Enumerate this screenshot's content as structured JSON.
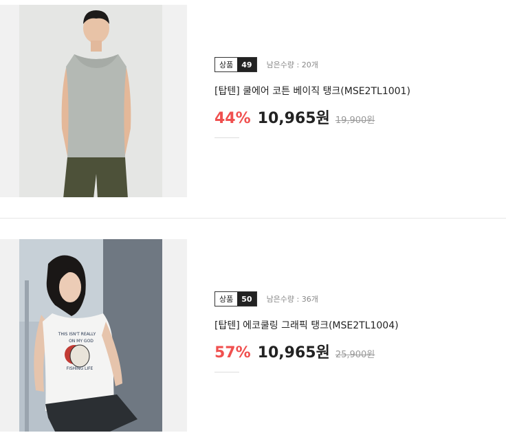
{
  "products": [
    {
      "badge_label": "상품",
      "badge_number": "49",
      "stock": "남은수량 : 20개",
      "title": "[탑텐] 쿨에어 코튼 베이직 탱크(MSE2TL1001)",
      "discount": "44%",
      "price": "10,965원",
      "original_price": "19,900원"
    },
    {
      "badge_label": "상품",
      "badge_number": "50",
      "stock": "남은수량 : 36개",
      "title": "[탑텐] 에코쿨링 그래픽 탱크(MSE2TL1004)",
      "discount": "57%",
      "price": "10,965원",
      "original_price": "25,900원",
      "shirt_print": [
        "THIS ISN'T REALLY",
        "ON MY GOD",
        "FISHING LIFE"
      ]
    }
  ],
  "colors": {
    "discount": "#f0504f",
    "badge_dark": "#222222",
    "accent_text": "#222222"
  }
}
